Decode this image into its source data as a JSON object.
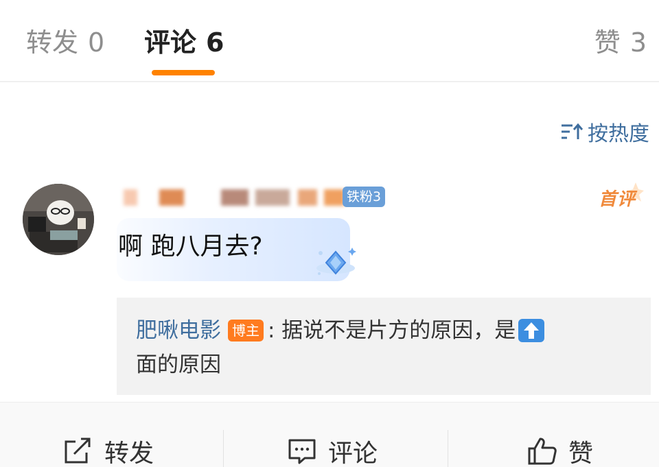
{
  "tabs": {
    "repost": {
      "label": "转发",
      "count": "0"
    },
    "comment": {
      "label": "评论",
      "count": "6"
    },
    "like": {
      "label": "赞",
      "count": "3"
    },
    "active_color": "#ff8200"
  },
  "sort": {
    "label": "按热度",
    "icon": "sort-icon",
    "color": "#3f6e9e"
  },
  "comment": {
    "fan_badge": "铁粉3",
    "first_comment_label": "首评",
    "text": "啊 跑八月去?"
  },
  "reply": {
    "author": "肥啾电影",
    "author_badge": "博主",
    "text_line1": ": 据说不是片方的原因，是",
    "emoji": "up-arrow-emoji",
    "text_line2": "面的原因"
  },
  "actions": {
    "repost": {
      "label": "转发",
      "icon": "share-icon"
    },
    "comment": {
      "label": "评论",
      "icon": "comment-icon"
    },
    "like": {
      "label": "赞",
      "icon": "thumbs-up-icon"
    }
  }
}
